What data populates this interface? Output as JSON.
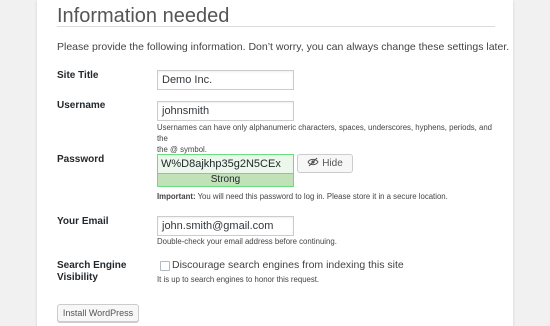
{
  "heading": "Information needed",
  "intro": "Please provide the following information. Don’t worry, you can always change these settings later.",
  "site_title": {
    "label": "Site Title",
    "value": "Demo Inc."
  },
  "username": {
    "label": "Username",
    "value": "johnsmith",
    "help_line1": "Usernames can have only alphanumeric characters, spaces, underscores, hyphens, periods, and the",
    "help_line2": "the @ symbol."
  },
  "password": {
    "label": "Password",
    "value": "W%D8ajkhp35g2N5CEx",
    "strength": "Strong",
    "hide_label": "Hide",
    "hide_icon": "eye-slash-icon",
    "important_label": "Important:",
    "important_text": " You will need this password to log in. Please store it in a secure location."
  },
  "email": {
    "label": "Your Email",
    "value": "john.smith@gmail.com",
    "help": "Double-check your email address before continuing."
  },
  "search_engine": {
    "label_line1": "Search Engine",
    "label_line2": "Visibility",
    "checkbox_label": "Discourage search engines from indexing this site",
    "checked": false,
    "help": "It is up to search engines to honor this request."
  },
  "install_button": "Install WordPress",
  "colors": {
    "strong_bg": "#c1e1b9",
    "strong_border": "#68de7c",
    "page_bg": "#f1f1f1"
  }
}
